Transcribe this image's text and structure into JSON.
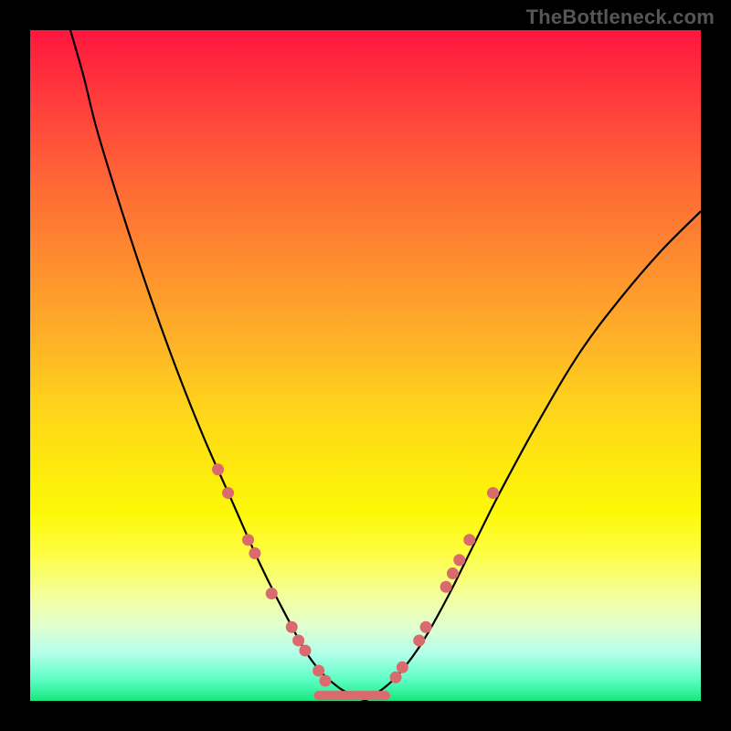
{
  "attribution": "TheBottleneck.com",
  "chart_data": {
    "type": "line",
    "title": "",
    "xlabel": "",
    "ylabel": "",
    "xlim": [
      0,
      100
    ],
    "ylim": [
      0,
      100
    ],
    "grid": false,
    "series": [
      {
        "name": "left-curve",
        "values_xy": [
          [
            6,
            100
          ],
          [
            8,
            93
          ],
          [
            10,
            85
          ],
          [
            14,
            72
          ],
          [
            18,
            60
          ],
          [
            22,
            49
          ],
          [
            26,
            39
          ],
          [
            30,
            30
          ],
          [
            34,
            21
          ],
          [
            38,
            13
          ],
          [
            42,
            6
          ],
          [
            46,
            2
          ],
          [
            50,
            0
          ]
        ]
      },
      {
        "name": "right-curve",
        "values_xy": [
          [
            50,
            0
          ],
          [
            54,
            3
          ],
          [
            58,
            8
          ],
          [
            62,
            15
          ],
          [
            66,
            23
          ],
          [
            70,
            31
          ],
          [
            76,
            42
          ],
          [
            82,
            52
          ],
          [
            88,
            60
          ],
          [
            94,
            67
          ],
          [
            100,
            73
          ]
        ]
      },
      {
        "name": "trough-bar",
        "values_xy": [
          [
            43,
            0.8
          ],
          [
            53,
            0.8
          ]
        ]
      }
    ],
    "points": [
      {
        "series": "left",
        "x": 28.0,
        "y": 34.5
      },
      {
        "series": "left",
        "x": 29.5,
        "y": 31.0
      },
      {
        "series": "left",
        "x": 32.5,
        "y": 24.0
      },
      {
        "series": "left",
        "x": 33.5,
        "y": 22.0
      },
      {
        "series": "left",
        "x": 36.0,
        "y": 16.0
      },
      {
        "series": "left",
        "x": 39.0,
        "y": 11.0
      },
      {
        "series": "left",
        "x": 40.0,
        "y": 9.0
      },
      {
        "series": "left",
        "x": 41.0,
        "y": 7.5
      },
      {
        "series": "left",
        "x": 43.0,
        "y": 4.5
      },
      {
        "series": "left",
        "x": 44.0,
        "y": 3.0
      },
      {
        "series": "right",
        "x": 54.5,
        "y": 3.5
      },
      {
        "series": "right",
        "x": 55.5,
        "y": 5.0
      },
      {
        "series": "right",
        "x": 58.0,
        "y": 9.0
      },
      {
        "series": "right",
        "x": 59.0,
        "y": 11.0
      },
      {
        "series": "right",
        "x": 62.0,
        "y": 17.0
      },
      {
        "series": "right",
        "x": 63.0,
        "y": 19.0
      },
      {
        "series": "right",
        "x": 64.0,
        "y": 21.0
      },
      {
        "series": "right",
        "x": 65.5,
        "y": 24.0
      },
      {
        "series": "right",
        "x": 69.0,
        "y": 31.0
      }
    ],
    "colors": {
      "curve": "#000000",
      "points": "#d96a6e",
      "bg_top": "#ff163e",
      "bg_bottom": "#16e87d"
    }
  }
}
